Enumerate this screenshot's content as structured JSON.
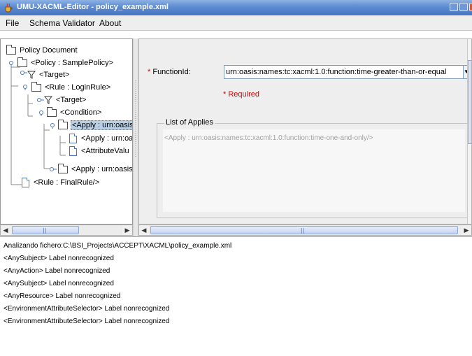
{
  "window": {
    "title": "UMU-XACML-Editor - policy_example.xml"
  },
  "menu": {
    "items": [
      "File",
      "Schema Validator",
      "About"
    ]
  },
  "tree": {
    "nodes": [
      {
        "label": "Policy Document",
        "icon": "folder-icon",
        "toggle": ""
      },
      {
        "label": "<Policy : SamplePolicy>",
        "icon": "folder-icon",
        "toggle": "expanded"
      },
      {
        "label": "<Target>",
        "icon": "funnel-icon",
        "toggle": "collapsed"
      },
      {
        "label": "<Rule : LoginRule>",
        "icon": "folder-icon",
        "toggle": "expanded"
      },
      {
        "label": "<Target>",
        "icon": "funnel-icon",
        "toggle": "collapsed"
      },
      {
        "label": "<Condition>",
        "icon": "folder-icon",
        "toggle": "expanded"
      },
      {
        "label": "<Apply : urn:oasis",
        "icon": "folder-icon",
        "toggle": "expanded",
        "selected": true
      },
      {
        "label": "<Apply : urn:oa",
        "icon": "document-icon",
        "toggle": ""
      },
      {
        "label": "<AttributeValu",
        "icon": "document-icon",
        "toggle": ""
      },
      {
        "label": "<Apply : urn:oasis",
        "icon": "folder-icon",
        "toggle": "collapsed"
      },
      {
        "label": "<Rule : FinalRule/>",
        "icon": "document-icon",
        "toggle": ""
      }
    ]
  },
  "editor": {
    "function_label": "FunctionId:",
    "required_star": "*",
    "function_value": "urn:oasis:names:tc:xacml:1.0:function:time-greater-than-or-equal",
    "required_text": "* Required",
    "applies_legend": "List of Applies",
    "applies": [
      "<Apply : urn:oasis:names:tc:xacml:1.0:function:time-one-and-only/>"
    ]
  },
  "log": {
    "lines": [
      "Analizando fichero:C:\\BSI_Projects\\ACCEPT\\XACML\\policy_example.xml",
      "<AnySubject> Label nonrecognized",
      "<AnyAction> Label nonrecognized",
      "<AnySubject> Label nonrecognized",
      "<AnyResource> Label nonrecognized",
      "<EnvironmentAttributeSelector> Label nonrecognized",
      "<EnvironmentAttributeSelector> Label nonrecognized"
    ]
  },
  "colors": {
    "titlebar": "#5d8bd1",
    "required": "#d00000",
    "selection": "#b8cfe5"
  }
}
